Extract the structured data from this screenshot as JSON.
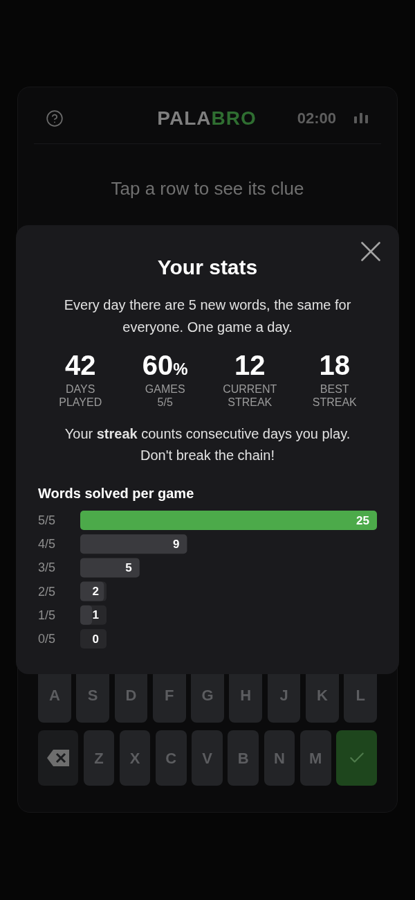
{
  "header": {
    "logo": {
      "first": "PALA",
      "accent": "BRO"
    },
    "timer": "02:00"
  },
  "hint": "Tap a row to see its clue",
  "stats_dialog": {
    "title": "Your stats",
    "intro": "Every day there are 5 new words, the same for everyone. One game a day.",
    "stats": [
      {
        "value": "42",
        "label_lines": [
          "DAYS",
          "PLAYED"
        ]
      },
      {
        "value": "60",
        "unit": "%",
        "label_lines": [
          "GAMES",
          "5/5"
        ]
      },
      {
        "value": "12",
        "label_lines": [
          "CURRENT",
          "STREAK"
        ]
      },
      {
        "value": "18",
        "label_lines": [
          "BEST",
          "STREAK"
        ]
      }
    ],
    "note_lines": [
      "Your **streak** counts consecutive days you play.",
      "Don't break the chain!"
    ],
    "chart_data": {
      "type": "bar",
      "orientation": "horizontal",
      "title": "Words solved per game",
      "categories": [
        "5/5",
        "4/5",
        "3/5",
        "2/5",
        "1/5",
        "0/5"
      ],
      "series": [
        {
          "color": "#4caa4a",
          "values": [
            25,
            null,
            null,
            null,
            null,
            null
          ]
        },
        {
          "color": "#3a3a3e",
          "values": [
            null,
            9,
            5,
            2,
            1,
            0
          ]
        }
      ],
      "data_labels": true
    }
  },
  "keyboard": {
    "rows": [
      [
        {
          "kind": "letter",
          "label": "A"
        },
        {
          "kind": "letter",
          "label": "S"
        },
        {
          "kind": "letter",
          "label": "D"
        },
        {
          "kind": "letter",
          "label": "F"
        },
        {
          "kind": "letter",
          "label": "G"
        },
        {
          "kind": "letter",
          "label": "H"
        },
        {
          "kind": "letter",
          "label": "J"
        },
        {
          "kind": "letter",
          "label": "K"
        },
        {
          "kind": "letter",
          "label": "L"
        }
      ],
      [
        {
          "kind": "backspace"
        },
        {
          "kind": "letter",
          "label": "Z"
        },
        {
          "kind": "letter",
          "label": "X"
        },
        {
          "kind": "letter",
          "label": "C"
        },
        {
          "kind": "letter",
          "label": "V"
        },
        {
          "kind": "letter",
          "label": "B"
        },
        {
          "kind": "letter",
          "label": "N"
        },
        {
          "kind": "letter",
          "label": "M"
        },
        {
          "kind": "enter"
        }
      ]
    ]
  }
}
